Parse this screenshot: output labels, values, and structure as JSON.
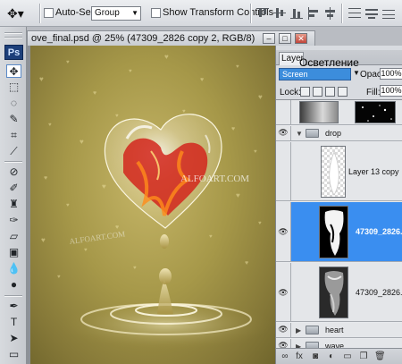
{
  "optbar": {
    "auto_select_label": "Auto-Select:",
    "auto_select_value": "Group",
    "transform_label": "Show Transform Controls"
  },
  "toolbox": {
    "logo": "Ps",
    "tools": [
      "move",
      "marquee",
      "lasso",
      "quick-select",
      "crop",
      "eyedropper",
      "healing",
      "brush",
      "stamp",
      "history-brush",
      "eraser",
      "gradient",
      "blur",
      "dodge",
      "pen",
      "type",
      "path-select",
      "shape",
      "3d"
    ]
  },
  "document": {
    "title": "ove_final.psd @ 25% (47309_2826 copy 2, RGB/8)",
    "watermark": "ALFOART.COM"
  },
  "layers_panel": {
    "tab_label": "Layers",
    "tooltip": "Осветление",
    "blend_mode": "Screen",
    "opacity_label": "Opacity:",
    "opacity_value": "100%",
    "lock_label": "Lock:",
    "fill_label": "Fill:",
    "fill_value": "100%",
    "layers": [
      {
        "name": "",
        "type": "layer"
      },
      {
        "name": "drop",
        "type": "group"
      },
      {
        "name": "Layer 13 copy",
        "type": "layer"
      },
      {
        "name": "47309_2826...",
        "type": "layer",
        "selected": true
      },
      {
        "name": "47309_2826...",
        "type": "layer"
      },
      {
        "name": "heart",
        "type": "group"
      },
      {
        "name": "wave",
        "type": "group"
      }
    ]
  },
  "colors": {
    "selection": "#3a8ef0",
    "canvas_bg": "#a69849",
    "heart_red": "#d2261c"
  }
}
